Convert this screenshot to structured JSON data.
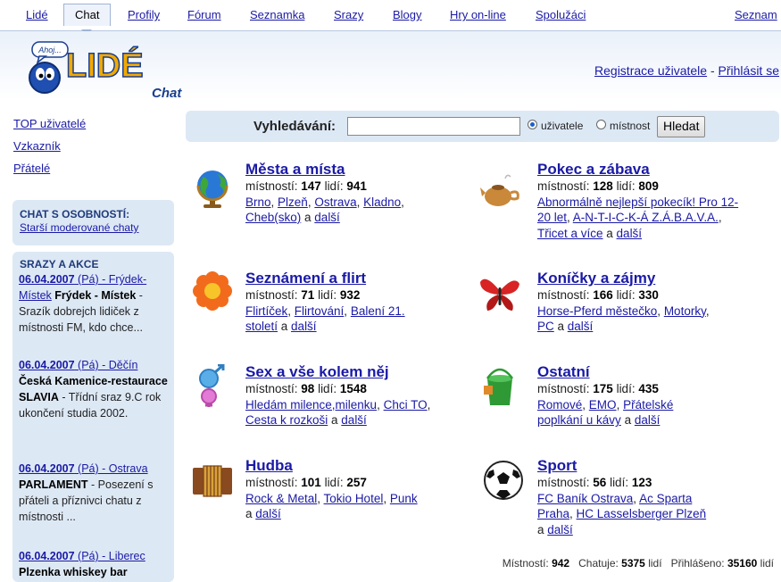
{
  "nav": {
    "items": [
      "Lidé",
      "Chat",
      "Profily",
      "Fórum",
      "Seznamka",
      "Srazy",
      "Blogy",
      "Hry on-line",
      "Spolužáci",
      "Seznam"
    ]
  },
  "header": {
    "logo_bubble": "Ahoj...",
    "logo_text": "LIDÉ",
    "logo_sub": "Chat",
    "register": "Registrace uživatele",
    "separator": " - ",
    "login": "Přihlásit se"
  },
  "sidebar": {
    "links": [
      "TOP uživatelé",
      "Vzkazník",
      "Přátelé"
    ],
    "celeb_title": "CHAT S OSOBNOSTÍ:",
    "celeb_link": "Starší moderované chaty",
    "events_title": "SRAZY A AKCE",
    "events": [
      {
        "date": "06.04.2007",
        "rest": " (Pá) - Frýdek-Místek",
        "name": "Frýdek - Místek",
        "desc": " - Srazík dobrejch lidiček z místnosti FM, kdo chce..."
      },
      {
        "date": "06.04.2007",
        "rest": " (Pá) - Děčín",
        "name": "Česká Kamenice-restaurace SLAVIA",
        "desc": " - Třídní sraz 9.C rok ukončení studia 2002."
      },
      {
        "date": "06.04.2007",
        "rest": " (Pá) - Ostrava",
        "name": "PARLAMENT",
        "desc": " - Posezení s přáteli a příznivci chatu z místnosti ..."
      },
      {
        "date": "06.04.2007",
        "rest": " (Pá) - Liberec",
        "name": "Plzenka whiskey bar",
        "desc": ""
      }
    ]
  },
  "search": {
    "label": "Vyhledávání:",
    "value": "",
    "opt_users": "uživatele",
    "opt_rooms": "místnost",
    "button": "Hledat"
  },
  "categories": [
    {
      "title": "Města a místa",
      "rooms_label": "místností: ",
      "rooms": "147",
      "people_label": " lidí: ",
      "people": "941",
      "links": [
        "Brno",
        "Plzeň",
        "Ostrava",
        "Kladno",
        "Cheb(sko)"
      ],
      "more_sep": " a ",
      "more": "další",
      "icon": "globe-icon"
    },
    {
      "title": "Pokec a zábava",
      "rooms_label": "místností: ",
      "rooms": "128",
      "people_label": " lidí: ",
      "people": "809",
      "links": [
        "Abnormálně nejlepší pokecík! Pro 12-20 let",
        "A-N-T-I-C-K-Á Z.Á.B.A.V.A.",
        "Třicet a více"
      ],
      "more_sep": " a ",
      "more": "další",
      "icon": "teapot-icon"
    },
    {
      "title": "Seznámení a flirt",
      "rooms_label": "místností: ",
      "rooms": "71",
      "people_label": " lidí: ",
      "people": "932",
      "links": [
        "Flirtíček",
        "Flirtování",
        "Balení 21. století"
      ],
      "more_sep": " a ",
      "more": "další",
      "icon": "flower-icon"
    },
    {
      "title": "Koníčky a zájmy",
      "rooms_label": "místností: ",
      "rooms": "166",
      "people_label": " lidí: ",
      "people": "330",
      "links": [
        "Horse-Pferd městečko",
        "Motorky",
        "PC"
      ],
      "more_sep": " a ",
      "more": "další",
      "icon": "butterfly-icon"
    },
    {
      "title": "Sex a vše kolem něj",
      "rooms_label": "místností: ",
      "rooms": "98",
      "people_label": " lidí: ",
      "people": "1548",
      "links": [
        "Hledám milence,milenku",
        "Chci TO",
        "Cesta k rozkoši"
      ],
      "more_sep": " a ",
      "more": "další",
      "icon": "gender-symbols-icon"
    },
    {
      "title": "Ostatní",
      "rooms_label": "místností: ",
      "rooms": "175",
      "people_label": " lidí: ",
      "people": "435",
      "links": [
        "Romové",
        "EMO",
        "Přátelské poplkání u kávy"
      ],
      "more_sep": " a ",
      "more": "další",
      "icon": "bucket-icon"
    },
    {
      "title": "Hudba",
      "rooms_label": "místností: ",
      "rooms": "101",
      "people_label": " lidí: ",
      "people": "257",
      "links": [
        "Rock & Metal",
        "Tokio Hotel",
        "Punk"
      ],
      "more_sep": " a ",
      "more": "další",
      "icon": "accordion-icon"
    },
    {
      "title": "Sport",
      "rooms_label": "místností: ",
      "rooms": "56",
      "people_label": " lidí: ",
      "people": "123",
      "links": [
        "FC Baník Ostrava",
        "Ac Sparta Praha",
        "HC Lasselsberger Plzeň"
      ],
      "more_sep": " a ",
      "more": "další",
      "icon": "soccer-ball-icon"
    }
  ],
  "footer": {
    "rooms_label": "Místností: ",
    "rooms": "942",
    "chat_label": "Chatuje: ",
    "chat": "5375",
    "chat_unit": " lidí",
    "logged_label": "Přihlášeno: ",
    "logged": "35160",
    "logged_unit": " lidí"
  }
}
